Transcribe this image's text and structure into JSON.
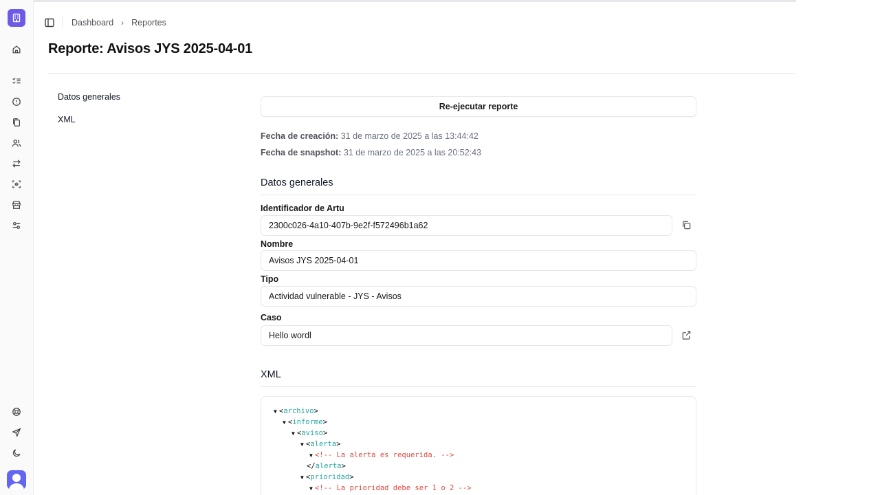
{
  "sidebar": {
    "items": [
      {
        "icon": "home-icon"
      },
      {
        "icon": "checklist-icon"
      },
      {
        "icon": "shield-icon"
      },
      {
        "icon": "copy-files-icon"
      },
      {
        "icon": "users-icon"
      },
      {
        "icon": "transfer-arrows-icon"
      },
      {
        "icon": "scan-icon"
      },
      {
        "icon": "store-icon"
      },
      {
        "icon": "settings-sliders-icon"
      }
    ],
    "bottom_items": [
      {
        "icon": "help-lifebuoy-icon"
      },
      {
        "icon": "send-icon"
      },
      {
        "icon": "moon-icon"
      }
    ]
  },
  "breadcrumb": {
    "items": [
      "Dashboard",
      "Reportes"
    ]
  },
  "page": {
    "title": "Reporte: Avisos JYS 2025-04-01"
  },
  "nav": {
    "items": [
      "Datos generales",
      "XML"
    ]
  },
  "actions": {
    "rerun_label": "Re-ejecutar reporte"
  },
  "meta": {
    "created_label": "Fecha de creación:",
    "created_value": "31 de marzo de 2025 a las 13:44:42",
    "snapshot_label": "Fecha de snapshot:",
    "snapshot_value": "31 de marzo de 2025 a las 20:52:43"
  },
  "general": {
    "title": "Datos generales",
    "fields": {
      "id_label": "Identificador de Artu",
      "id_value": "2300c026-4a10-407b-9e2f-f572496b1a62",
      "name_label": "Nombre",
      "name_value": "Avisos JYS 2025-04-01",
      "type_label": "Tipo",
      "type_value": "Actividad vulnerable - JYS - Avisos",
      "case_label": "Caso",
      "case_value": "Hello wordl"
    }
  },
  "xml": {
    "title": "XML",
    "lines": [
      {
        "kind": "open",
        "tag": "archivo",
        "expanded": true
      },
      {
        "kind": "open",
        "tag": "informe",
        "expanded": true
      },
      {
        "kind": "open",
        "tag": "aviso",
        "expanded": true
      },
      {
        "kind": "open",
        "tag": "alerta",
        "expanded": true
      },
      {
        "kind": "comment",
        "text": "<!-- La alerta es requerida. -->"
      },
      {
        "kind": "close",
        "tag": "alerta"
      },
      {
        "kind": "open",
        "tag": "prioridad",
        "expanded": true
      },
      {
        "kind": "comment",
        "text": "<!-- La prioridad debe ser 1 o 2 -->"
      }
    ]
  },
  "colors": {
    "accent": "#6d5ae6",
    "xml_tag": "#22a6a0",
    "xml_comment": "#e0483f"
  }
}
